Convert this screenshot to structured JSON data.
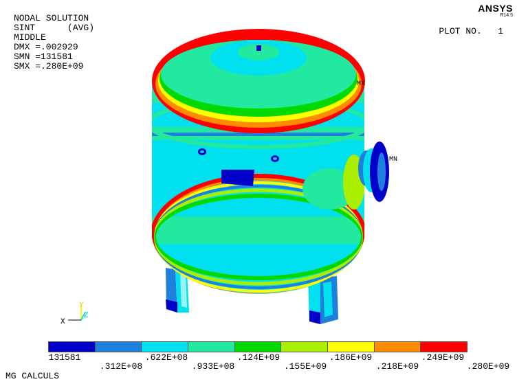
{
  "header": {
    "lines": [
      "NODAL SOLUTION",
      "SINT      (AVG)",
      "MIDDLE",
      "DMX =.002929",
      "SMN =131581",
      "SMX =.280E+09"
    ],
    "brand": "ANSYS",
    "version": "R14.5",
    "plot_label": "PLOT NO.   1"
  },
  "markers": {
    "max": "MX",
    "min": "MN"
  },
  "triad": {
    "x": "X",
    "y": "Y",
    "z": "Z"
  },
  "legend": {
    "colors": [
      "#0000c8",
      "#1f7fdc",
      "#00e0ee",
      "#22e8a0",
      "#00d800",
      "#aaee00",
      "#ffff00",
      "#ff8c00",
      "#ff0000"
    ],
    "labels_bottom": [
      "131581",
      ".622E+08",
      ".124E+09",
      ".186E+09",
      ".249E+09"
    ],
    "labels_top": [
      ".312E+08",
      ".933E+08",
      ".155E+09",
      ".218E+09",
      ".280E+09"
    ]
  },
  "footer": "MG CALCULS"
}
